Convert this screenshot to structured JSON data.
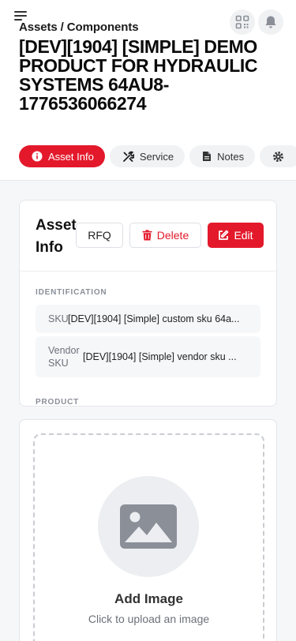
{
  "header": {
    "breadcrumb": "Assets / Components",
    "title": "[DEV][1904] [SIMPLE] DEMO PRODUCT FOR HYDRAULIC SYSTEMS 64AU8-1776536066274"
  },
  "tabs": [
    {
      "label": "Asset Info",
      "icon": "info-icon",
      "active": true
    },
    {
      "label": "Service",
      "icon": "tools-icon",
      "active": false
    },
    {
      "label": "Notes",
      "icon": "document-icon",
      "active": false
    },
    {
      "label": "",
      "icon": "gear-icon",
      "active": false
    }
  ],
  "asset_info": {
    "title": "Asset Info",
    "buttons": {
      "rfq": "RFQ",
      "delete": "Delete",
      "edit": "Edit"
    },
    "sections": {
      "identification": "IDENTIFICATION",
      "product": "PRODUCT"
    },
    "fields": [
      {
        "label": "SKU",
        "value": "[DEV][1904] [Simple] custom sku 64a..."
      },
      {
        "label": "Vendor SKU",
        "value": "[DEV][1904] [Simple] vendor sku ..."
      }
    ]
  },
  "image_upload": {
    "title": "Add Image",
    "hint": "Click to upload an image"
  },
  "colors": {
    "accent": "#e3192b",
    "muted": "#8a8f98",
    "background": "#f6f7f9"
  }
}
